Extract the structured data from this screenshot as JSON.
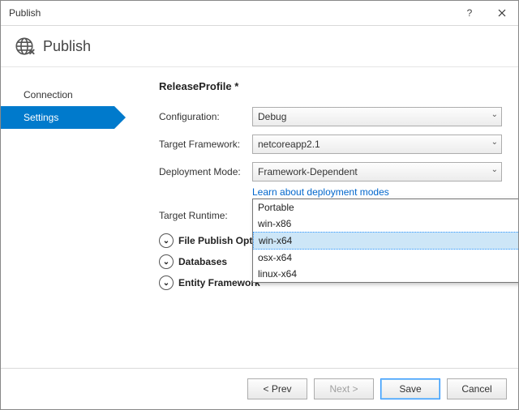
{
  "window": {
    "title": "Publish"
  },
  "header": {
    "title": "Publish"
  },
  "sidebar": {
    "items": [
      {
        "label": "Connection",
        "active": false
      },
      {
        "label": "Settings",
        "active": true
      }
    ]
  },
  "main": {
    "profile_title": "ReleaseProfile *",
    "fields": {
      "configuration": {
        "label": "Configuration:",
        "value": "Debug"
      },
      "target_framework": {
        "label": "Target Framework:",
        "value": "netcoreapp2.1"
      },
      "deployment_mode": {
        "label": "Deployment Mode:",
        "value": "Framework-Dependent",
        "link": "Learn about deployment modes"
      },
      "target_runtime": {
        "label": "Target Runtime:",
        "value": "win-x64"
      }
    },
    "runtime_options": [
      {
        "label": "Portable",
        "selected": false
      },
      {
        "label": "win-x86",
        "selected": false
      },
      {
        "label": "win-x64",
        "selected": true
      },
      {
        "label": "osx-x64",
        "selected": false
      },
      {
        "label": "linux-x64",
        "selected": false
      }
    ],
    "expanders": [
      {
        "label": "File Publish Options"
      },
      {
        "label": "Databases"
      },
      {
        "label": "Entity Framework"
      }
    ]
  },
  "footer": {
    "prev": "< Prev",
    "next": "Next >",
    "save": "Save",
    "cancel": "Cancel"
  }
}
